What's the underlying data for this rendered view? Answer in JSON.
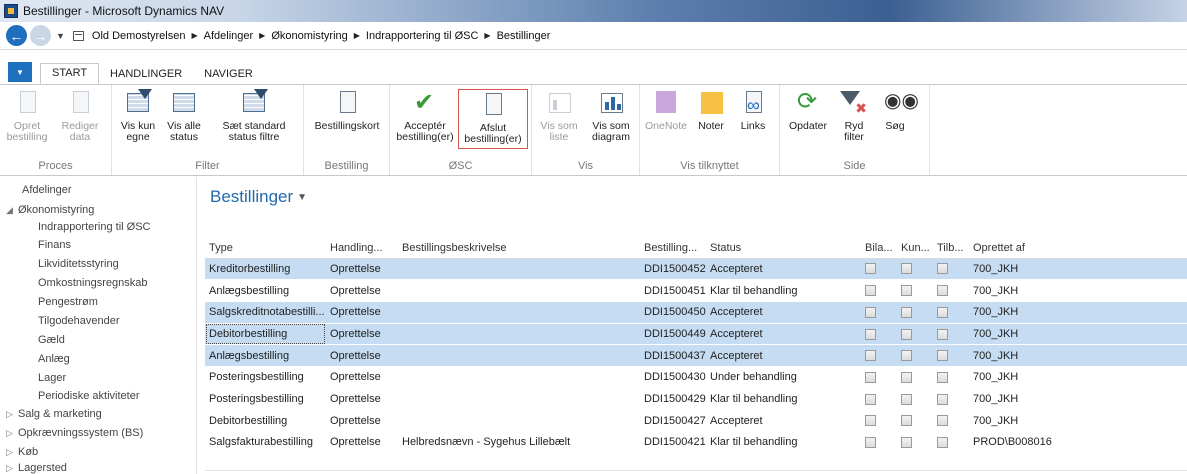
{
  "window": {
    "title": "Bestillinger - Microsoft Dynamics NAV"
  },
  "address": {
    "crumbs": [
      "Old Demostyrelsen",
      "Afdelinger",
      "Økonomistyring",
      "Indrapportering til ØSC",
      "Bestillinger"
    ]
  },
  "ribbon": {
    "tabs": [
      "START",
      "HANDLINGER",
      "NAVIGER"
    ],
    "groups": {
      "proces": {
        "label": "Proces",
        "opret": "Opret\nbestilling",
        "rediger": "Rediger\ndata"
      },
      "filter": {
        "label": "Filter",
        "vis_kun_egne": "Vis kun\negne",
        "vis_alle_status": "Vis alle\nstatus",
        "saet_standard": "Sæt standard\nstatus filtre"
      },
      "bestilling": {
        "label": "Bestilling",
        "bestillingskort": "Bestillingskort"
      },
      "osc": {
        "label": "ØSC",
        "accepter": "Acceptér\nbestilling(er)",
        "afslut": "Afslut\nbestilling(er)"
      },
      "vis": {
        "label": "Vis",
        "vis_som_liste": "Vis som\nliste",
        "vis_som_diagram": "Vis som\ndiagram"
      },
      "vis_tilknyttet": {
        "label": "Vis tilknyttet",
        "onenote": "OneNote",
        "noter": "Noter",
        "links": "Links"
      },
      "side": {
        "label": "Side",
        "opdater": "Opdater",
        "ryd_filter": "Ryd\nfilter",
        "sog": "Søg"
      }
    }
  },
  "nav": {
    "items": [
      {
        "label": "Afdelinger"
      },
      {
        "label": "Økonomistyring"
      },
      {
        "label": "Indrapportering til ØSC"
      },
      {
        "label": "Finans"
      },
      {
        "label": "Likviditetsstyring"
      },
      {
        "label": "Omkostningsregnskab"
      },
      {
        "label": "Pengestrøm"
      },
      {
        "label": "Tilgodehavender"
      },
      {
        "label": "Gæld"
      },
      {
        "label": "Anlæg"
      },
      {
        "label": "Lager"
      },
      {
        "label": "Periodiske aktiviteter"
      },
      {
        "label": "Salg & marketing"
      },
      {
        "label": "Opkrævningssystem (BS)"
      },
      {
        "label": "Køb"
      },
      {
        "label": "Lagersted"
      }
    ]
  },
  "page": {
    "title": "Bestillinger"
  },
  "table": {
    "headers": [
      "Type",
      "Handling...",
      "Bestillingsbeskrivelse",
      "Bestilling...",
      "Status",
      "Bila...",
      "Kun...",
      "Tilb...",
      "Oprettet af"
    ],
    "rows": [
      {
        "type": "Kreditorbestilling",
        "handling": "Oprettelse",
        "beskrivelse": "",
        "bestilling": "DDI1500452",
        "status": "Accepteret",
        "oprettet_af": "700_JKH",
        "selected": true
      },
      {
        "type": "Anlægsbestilling",
        "handling": "Oprettelse",
        "beskrivelse": "",
        "bestilling": "DDI1500451",
        "status": "Klar til behandling",
        "oprettet_af": "700_JKH",
        "selected": false
      },
      {
        "type": "Salgskreditnotabestilli...",
        "handling": "Oprettelse",
        "beskrivelse": "",
        "bestilling": "DDI1500450",
        "status": "Accepteret",
        "oprettet_af": "700_JKH",
        "selected": true
      },
      {
        "type": "Debitorbestilling",
        "handling": "Oprettelse",
        "beskrivelse": "",
        "bestilling": "DDI1500449",
        "status": "Accepteret",
        "oprettet_af": "700_JKH",
        "selected": true
      },
      {
        "type": "Anlægsbestilling",
        "handling": "Oprettelse",
        "beskrivelse": "",
        "bestilling": "DDI1500437",
        "status": "Accepteret",
        "oprettet_af": "700_JKH",
        "selected": true
      },
      {
        "type": "Posteringsbestilling",
        "handling": "Oprettelse",
        "beskrivelse": "",
        "bestilling": "DDI1500430",
        "status": "Under behandling",
        "oprettet_af": "700_JKH",
        "selected": false
      },
      {
        "type": "Posteringsbestilling",
        "handling": "Oprettelse",
        "beskrivelse": "",
        "bestilling": "DDI1500429",
        "status": "Klar til behandling",
        "oprettet_af": "700_JKH",
        "selected": false
      },
      {
        "type": "Debitorbestilling",
        "handling": "Oprettelse",
        "beskrivelse": "",
        "bestilling": "DDI1500427",
        "status": "Accepteret",
        "oprettet_af": "700_JKH",
        "selected": false
      },
      {
        "type": "Salgsfakturabestilling",
        "handling": "Oprettelse",
        "beskrivelse": "Helbredsnævn - Sygehus Lillebælt",
        "bestilling": "DDI1500421",
        "status": "Klar til behandling",
        "oprettet_af": "PROD\\B008016",
        "selected": false
      }
    ]
  },
  "colors": {
    "accent": "#1f6aad",
    "selected_row": "#c5dcf2",
    "check_green": "#3a9a3a"
  }
}
